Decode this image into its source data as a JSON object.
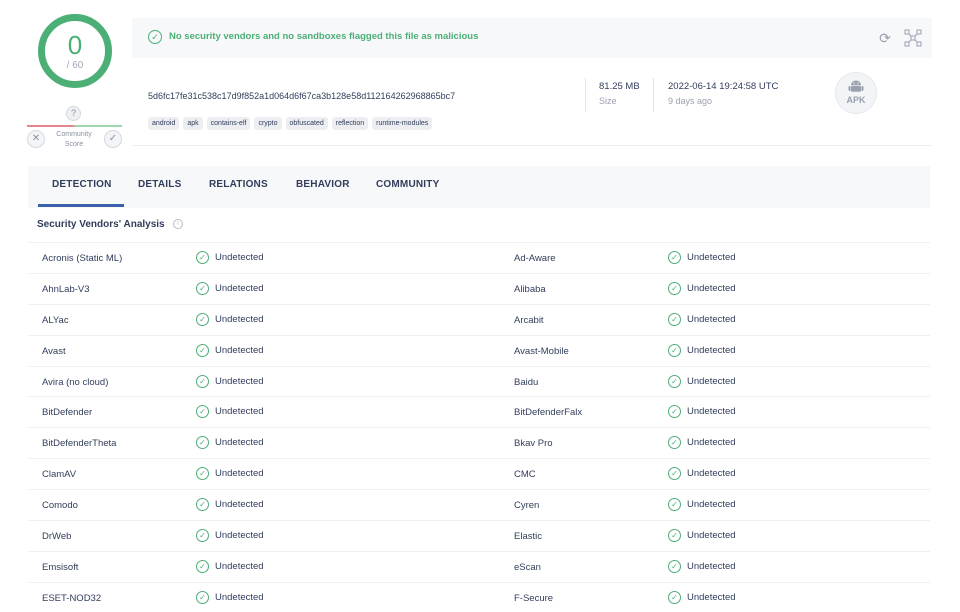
{
  "score": {
    "detections": "0",
    "total": "/ 60"
  },
  "community": {
    "question": "?",
    "label_line1": "Community",
    "label_line2": "Score"
  },
  "banner": {
    "message": "No security vendors and no sandboxes flagged this file as malicious"
  },
  "file": {
    "hash": "5d6fc17fe31c538c17d9f852a1d064d6f67ca3b128e58d112164262968865bc7",
    "tags": [
      "android",
      "apk",
      "contains-elf",
      "crypto",
      "obfuscated",
      "reflection",
      "runtime-modules"
    ],
    "size_value": "81.25 MB",
    "size_label": "Size",
    "date_value": "2022-06-14 19:24:58 UTC",
    "date_relative": "9 days ago",
    "type_badge": "APK"
  },
  "tabs": [
    "DETECTION",
    "DETAILS",
    "RELATIONS",
    "BEHAVIOR",
    "COMMUNITY"
  ],
  "section_title": "Security Vendors' Analysis",
  "vendors": [
    {
      "left": "Acronis (Static ML)",
      "left_result": "Undetected",
      "right": "Ad-Aware",
      "right_result": "Undetected"
    },
    {
      "left": "AhnLab-V3",
      "left_result": "Undetected",
      "right": "Alibaba",
      "right_result": "Undetected"
    },
    {
      "left": "ALYac",
      "left_result": "Undetected",
      "right": "Arcabit",
      "right_result": "Undetected"
    },
    {
      "left": "Avast",
      "left_result": "Undetected",
      "right": "Avast-Mobile",
      "right_result": "Undetected"
    },
    {
      "left": "Avira (no cloud)",
      "left_result": "Undetected",
      "right": "Baidu",
      "right_result": "Undetected"
    },
    {
      "left": "BitDefender",
      "left_result": "Undetected",
      "right": "BitDefenderFalx",
      "right_result": "Undetected"
    },
    {
      "left": "BitDefenderTheta",
      "left_result": "Undetected",
      "right": "Bkav Pro",
      "right_result": "Undetected"
    },
    {
      "left": "ClamAV",
      "left_result": "Undetected",
      "right": "CMC",
      "right_result": "Undetected"
    },
    {
      "left": "Comodo",
      "left_result": "Undetected",
      "right": "Cyren",
      "right_result": "Undetected"
    },
    {
      "left": "DrWeb",
      "left_result": "Undetected",
      "right": "Elastic",
      "right_result": "Undetected"
    },
    {
      "left": "Emsisoft",
      "left_result": "Undetected",
      "right": "eScan",
      "right_result": "Undetected"
    },
    {
      "left": "ESET-NOD32",
      "left_result": "Undetected",
      "right": "F-Secure",
      "right_result": "Undetected"
    }
  ],
  "colors": {
    "clean": "#4caf76",
    "accent": "#3b61ad",
    "text": "#313d5a"
  }
}
